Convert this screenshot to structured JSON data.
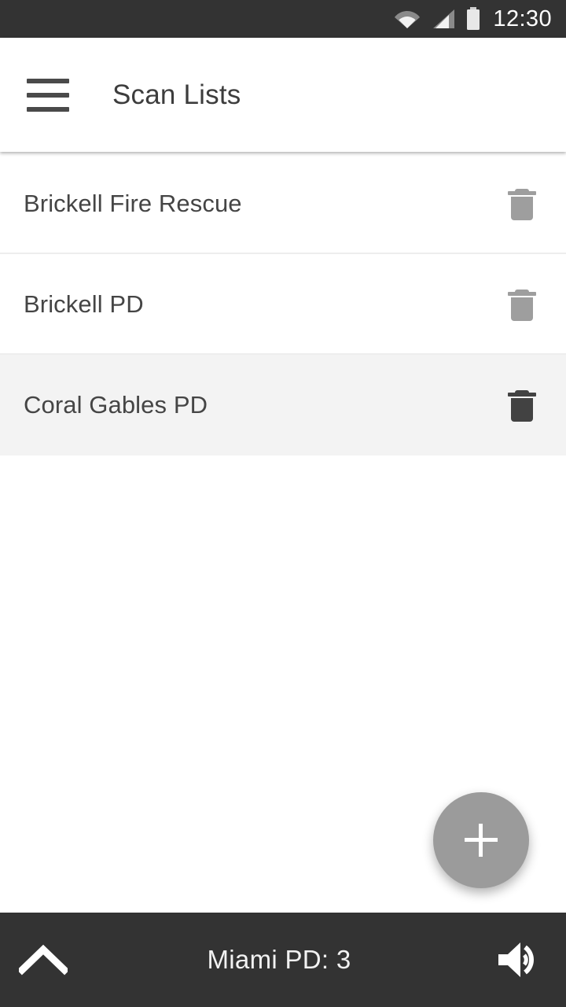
{
  "status_bar": {
    "time": "12:30",
    "icons": [
      "wifi-icon",
      "cellular-signal-icon",
      "battery-icon"
    ],
    "background": "#333333"
  },
  "app_bar": {
    "menu_icon": "hamburger-menu-icon",
    "title": "Scan Lists",
    "background": "#ffffff",
    "title_color": "#3d3d3d"
  },
  "list": {
    "delete_icon": "trash-icon",
    "rows": [
      {
        "label": "Brickell Fire Rescue",
        "selected": false,
        "trash_color": "#9e9e9e"
      },
      {
        "label": "Brickell PD",
        "selected": false,
        "trash_color": "#9e9e9e"
      },
      {
        "label": "Coral Gables PD",
        "selected": true,
        "trash_color": "#424242"
      }
    ]
  },
  "fab": {
    "icon": "plus-icon",
    "label": "",
    "color": "#9b9b9b"
  },
  "bottom_bar": {
    "expand_icon": "chevron-up-icon",
    "title": "Miami PD: 3",
    "volume_icon": "speaker-volume-icon",
    "background": "#333333",
    "text_color": "#f2f2f2"
  }
}
